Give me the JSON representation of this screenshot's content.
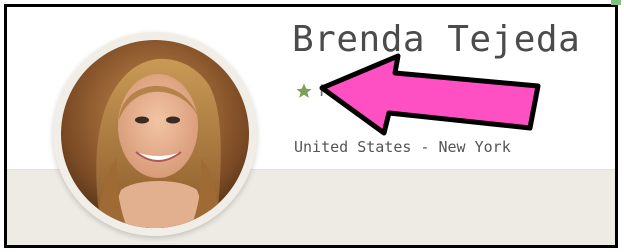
{
  "profile": {
    "name": "Brenda Tejeda",
    "badge_text": "F",
    "location": "United States - New York"
  },
  "icons": {
    "badge": "star-icon"
  },
  "colors": {
    "star": "#7aa05a",
    "arrow_fill": "#ff50c3",
    "arrow_stroke": "#000000",
    "banner": "#eeebe5"
  }
}
